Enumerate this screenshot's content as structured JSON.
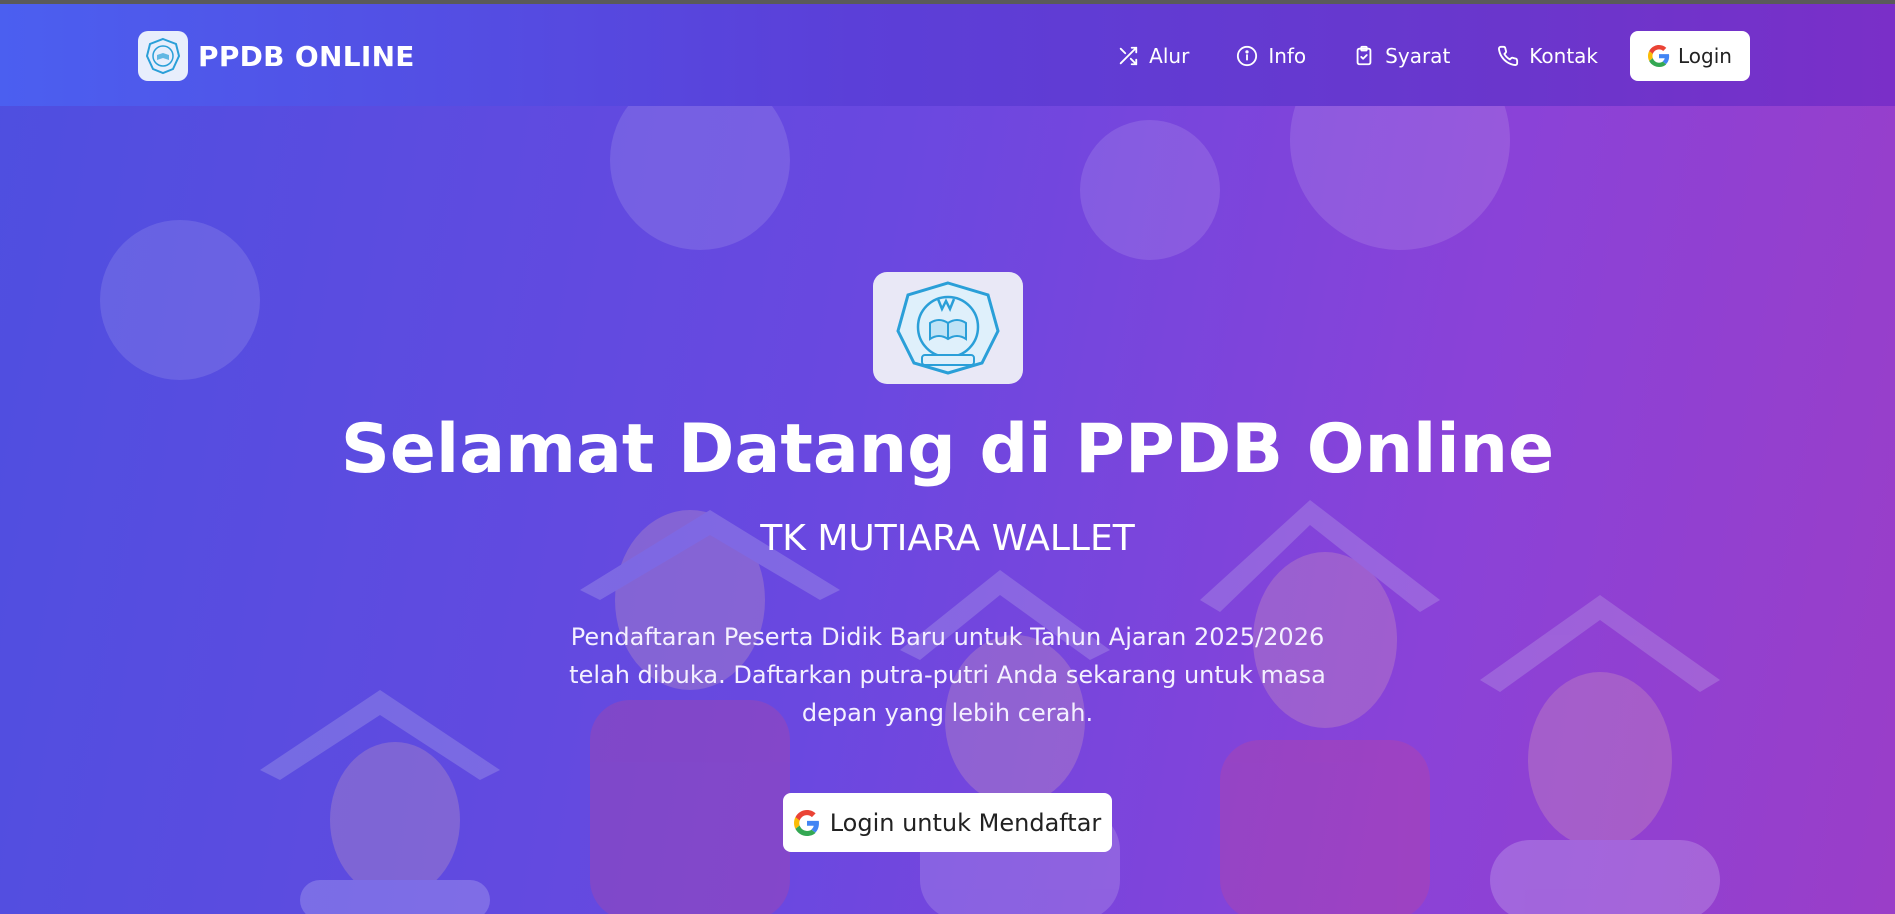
{
  "brand": {
    "name": "PPDB ONLINE",
    "logo_icon": "school-emblem-icon"
  },
  "nav": {
    "items": [
      {
        "label": "Alur",
        "icon": "shuffle-icon"
      },
      {
        "label": "Info",
        "icon": "info-circle-icon"
      },
      {
        "label": "Syarat",
        "icon": "clipboard-check-icon"
      },
      {
        "label": "Kontak",
        "icon": "phone-icon"
      }
    ],
    "login_label": "Login"
  },
  "hero": {
    "logo_icon": "school-emblem-icon",
    "title": "Selamat Datang di PPDB Online",
    "subtitle": "TK MUTIARA WALLET",
    "description": "Pendaftaran Peserta Didik Baru untuk Tahun Ajaran 2025/2026 telah dibuka. Daftarkan putra-putri Anda sekarang untuk masa depan yang lebih cerah.",
    "cta_label": "Login untuk Mendaftar"
  },
  "colors": {
    "gradient_start": "#4e4fe0",
    "gradient_end": "#9a3ec8",
    "button_bg": "#ffffff",
    "emblem_blue": "#2a9fd8"
  }
}
